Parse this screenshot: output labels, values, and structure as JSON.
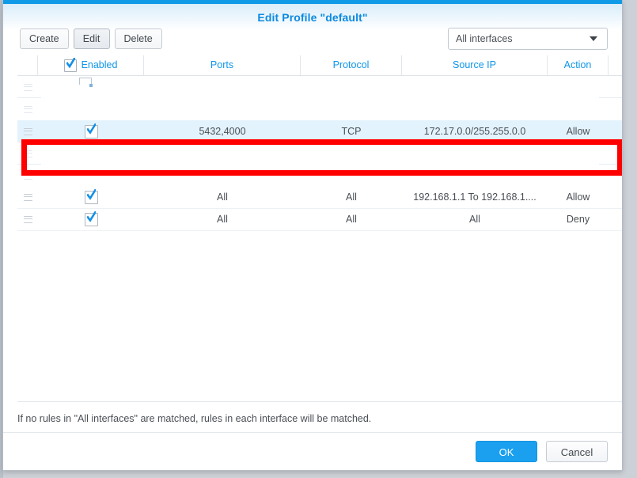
{
  "dialog": {
    "title": "Edit Profile \"default\"",
    "top_accent_color": "#0f9ae8",
    "title_color": "#0d8ae0"
  },
  "toolbar": {
    "create_label": "Create",
    "edit_label": "Edit",
    "delete_label": "Delete",
    "interface_selected": "All interfaces"
  },
  "grid": {
    "columns": [
      {
        "key": "handle",
        "label": ""
      },
      {
        "key": "enabled",
        "label": "Enabled"
      },
      {
        "key": "ports",
        "label": "Ports"
      },
      {
        "key": "protocol",
        "label": "Protocol"
      },
      {
        "key": "source_ip",
        "label": "Source IP"
      },
      {
        "key": "action",
        "label": "Action"
      }
    ],
    "header_checkbox_checked": true,
    "rows": [
      {
        "state": "ghost",
        "enabled": null,
        "ports": "",
        "protocol": "",
        "source_ip": "",
        "action": ""
      },
      {
        "state": "ghost",
        "enabled": null,
        "ports": "",
        "protocol": "",
        "source_ip": "",
        "action": ""
      },
      {
        "state": "highlighted",
        "enabled": true,
        "ports": "5432,4000",
        "protocol": "TCP",
        "source_ip": "172.17.0.0/255.255.0.0",
        "action": "Allow"
      },
      {
        "state": "ghost",
        "enabled": null,
        "ports": "",
        "protocol": "",
        "source_ip": "",
        "action": ""
      },
      {
        "state": "ghost",
        "enabled": null,
        "ports": "",
        "protocol": "",
        "source_ip": "",
        "action": ""
      },
      {
        "state": "normal",
        "enabled": true,
        "ports": "All",
        "protocol": "All",
        "source_ip": "192.168.1.1 To 192.168.1....",
        "action": "Allow"
      },
      {
        "state": "normal",
        "enabled": true,
        "ports": "All",
        "protocol": "All",
        "source_ip": "All",
        "action": "Deny"
      }
    ],
    "highlight_color": "#e3f3fd",
    "annotation_color": "#ff0000"
  },
  "footer": {
    "note": "If no rules in \"All interfaces\" are matched, rules in each interface will be matched.",
    "ok_label": "OK",
    "cancel_label": "Cancel",
    "ok_color": "#1aa0ee"
  }
}
